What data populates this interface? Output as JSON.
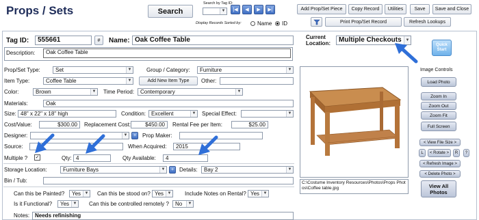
{
  "header": {
    "title": "Props / Sets",
    "search_label": "Search",
    "search_by_tag_label": "Search by Tag ID:",
    "sort_label": "Display Records Sorted by:",
    "sort_options": [
      "Name",
      "ID"
    ],
    "sort_selected": "ID",
    "nav": {
      "first": "|◀",
      "prev": "◀",
      "next": "▶",
      "last": "▶|"
    },
    "filter_icon": "filter-icon",
    "buttons": {
      "add_piece": "Add Prop/Set Piece",
      "copy_record": "Copy Record",
      "utilities": "Utilities",
      "save": "Save",
      "save_close": "Save and Close",
      "print": "Print Prop/Set Record",
      "refresh": "Refresh Lookups"
    }
  },
  "record": {
    "tag_id_label": "Tag ID:",
    "tag_id": "555661",
    "hash_label": "#",
    "name_label": "Name:",
    "name": "Oak Coffee Table",
    "current_location_label": "Current Location:",
    "current_location": "Multiple Checkouts",
    "description_label": "Description:",
    "description": "Oak Coffee Table",
    "prop_set_type_label": "Prop/Set Type:",
    "prop_set_type": "Set",
    "group_category_label": "Group / Category:",
    "group_category": "Furniture",
    "item_type_label": "Item Type:",
    "item_type": "Coffee Table",
    "add_item_type_label": "Add New Item Type",
    "other_label": "Other:",
    "other": "",
    "color_label": "Color:",
    "color": "Brown",
    "time_period_label": "Time Period:",
    "time_period": "Contemporary",
    "materials_label": "Materials:",
    "materials": "Oak",
    "size_label": "Size:",
    "size": "48\" x 22\" x 18\" high",
    "condition_label": "Condition:",
    "condition": "Excellent",
    "special_effect_label": "Special Effect:",
    "special_effect": "",
    "cost_value_label": "Cost/Value:",
    "cost_value": "$300.00",
    "replacement_cost_label": "Replacement Cost:",
    "replacement_cost": "$450.00",
    "rental_fee_label": "Rental Fee per Item:",
    "rental_fee": "$25.00",
    "designer_label": "Designer:",
    "designer": "",
    "plus": "+",
    "prop_maker_label": "Prop Maker:",
    "prop_maker": "",
    "source_label": "Source:",
    "source": "",
    "when_acquired_label": "When Acquired:",
    "when_acquired": "2015",
    "multiple_label": "Multiple ?",
    "multiple_checked": true,
    "qty_label": "Qty:",
    "qty": "4",
    "qty_available_label": "Qty Available:",
    "qty_available": "4",
    "storage_location_label": "Storage Location:",
    "storage_location": "Furniture Bays",
    "details_label": "Details:",
    "details": "Bay 2",
    "bin_tub_label": "Bin / Tub:",
    "bin_tub": "",
    "painted_label": "Can this be Painted?",
    "painted": "Yes",
    "stood_on_label": "Can this be stood on?",
    "stood_on": "Yes",
    "include_notes_label": "Include Notes on Rental?",
    "include_notes": "Yes",
    "functional_label": "Is it Functional?",
    "functional": "Yes",
    "remote_label": "Can this be controlled remotely ?",
    "remote": "No",
    "notes_label": "Notes:",
    "notes": "Needs refinishing"
  },
  "image_panel": {
    "quick_start": "Quick Start",
    "image_controls_label": "Image Controls",
    "load_photo": "Load Photo",
    "zoom_in": "Zoom In",
    "zoom_out": "Zoom Out",
    "zoom_fit": "Zoom Fit",
    "full_screen": "Full Screen",
    "view_file_size": "< View File Size >",
    "rotate_left": "L",
    "rotate": "< Rotate >",
    "rotate_right": "R",
    "help": "?",
    "refresh_image": "< Refresh Image >",
    "delete_photo": "< Delete Photo >",
    "view_all_photos": "View All Photos",
    "photo_path": "C:\\Costume Inventory Resources\\Photos\\Props Photos\\Coffee table.jpg"
  },
  "colors": {
    "title": "#1f2d5a",
    "arrow": "#2f6fd8",
    "panel_border": "#b7c0cf"
  }
}
